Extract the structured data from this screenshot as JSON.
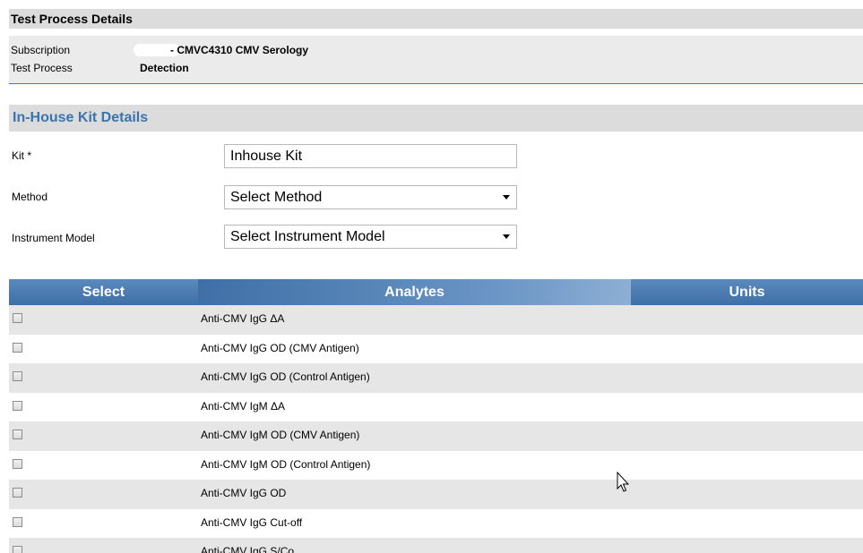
{
  "test_process": {
    "title": "Test Process Details",
    "subscription_label": "Subscription",
    "subscription_value": "̵̵̵̵̵ - CMVC4310 CMV Serology",
    "subscription_visible": "- CMVC4310 CMV Serology",
    "test_process_label": "Test Process",
    "test_process_value": "Detection"
  },
  "kit": {
    "title": "In-House Kit Details",
    "kit_label": "Kit *",
    "kit_value": "Inhouse Kit",
    "method_label": "Method",
    "method_value": "Select Method",
    "instrument_label": "Instrument Model",
    "instrument_value": "Select Instrument Model"
  },
  "table": {
    "headers": {
      "select": "Select",
      "analytes": "Analytes",
      "units": "Units"
    },
    "rows": [
      {
        "analyte": "Anti-CMV IgG ΔA",
        "units": ""
      },
      {
        "analyte": "Anti-CMV IgG OD (CMV Antigen)",
        "units": ""
      },
      {
        "analyte": "Anti-CMV IgG OD (Control Antigen)",
        "units": ""
      },
      {
        "analyte": "Anti-CMV IgM ΔA",
        "units": ""
      },
      {
        "analyte": "Anti-CMV IgM OD (CMV Antigen)",
        "units": ""
      },
      {
        "analyte": "Anti-CMV IgM OD (Control Antigen)",
        "units": ""
      },
      {
        "analyte": "Anti-CMV IgG OD",
        "units": ""
      },
      {
        "analyte": "Anti-CMV IgG Cut-off",
        "units": ""
      },
      {
        "analyte": "Anti-CMV IgG S/Co",
        "units": ""
      }
    ]
  },
  "colors": {
    "header_blue": "#3e6fa6",
    "title_blue": "#3b74ad",
    "panel_grey": "#dcdcdc",
    "row_alt": "#e6e6e6"
  }
}
